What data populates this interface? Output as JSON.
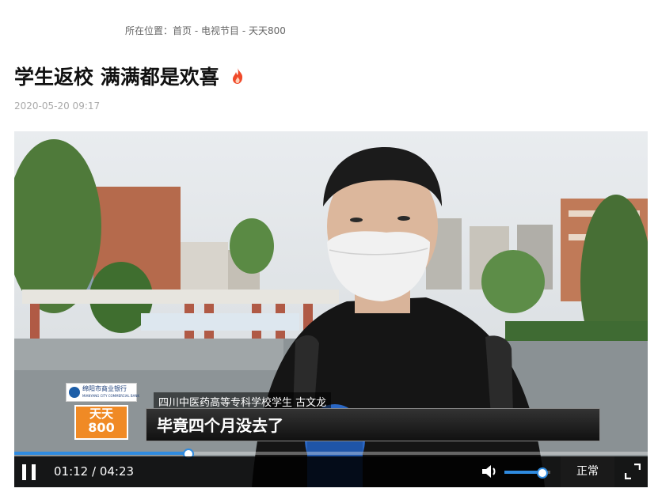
{
  "breadcrumb": {
    "prefix": "所在位置：",
    "home": "首页",
    "sep1": " - ",
    "section": "电视节目",
    "sep2": " - ",
    "current": "天天800"
  },
  "article": {
    "title": "学生返校 满满都是欢喜",
    "datetime": "2020-05-20 09:17"
  },
  "video": {
    "bank_logo_text": "绵阳市商业银行",
    "bank_logo_en": "MIANYANG CITY COMMERCIAL BANK",
    "show_logo_top": "天天",
    "show_logo_num": "800",
    "caption_name": "四川中医药高等专科学校学生 古文龙",
    "caption_text": "毕竟四个月没去了",
    "current_time": "01:12",
    "duration": "04:23",
    "time_sep": " / ",
    "progress_fraction": 0.274,
    "volume_fraction": 0.83,
    "speed_label": "正常",
    "accent_color": "#2f8be0"
  },
  "icons": {
    "hot": "flame-icon",
    "pause": "pause-icon",
    "volume": "volume-icon",
    "fullscreen": "fullscreen-icon"
  }
}
